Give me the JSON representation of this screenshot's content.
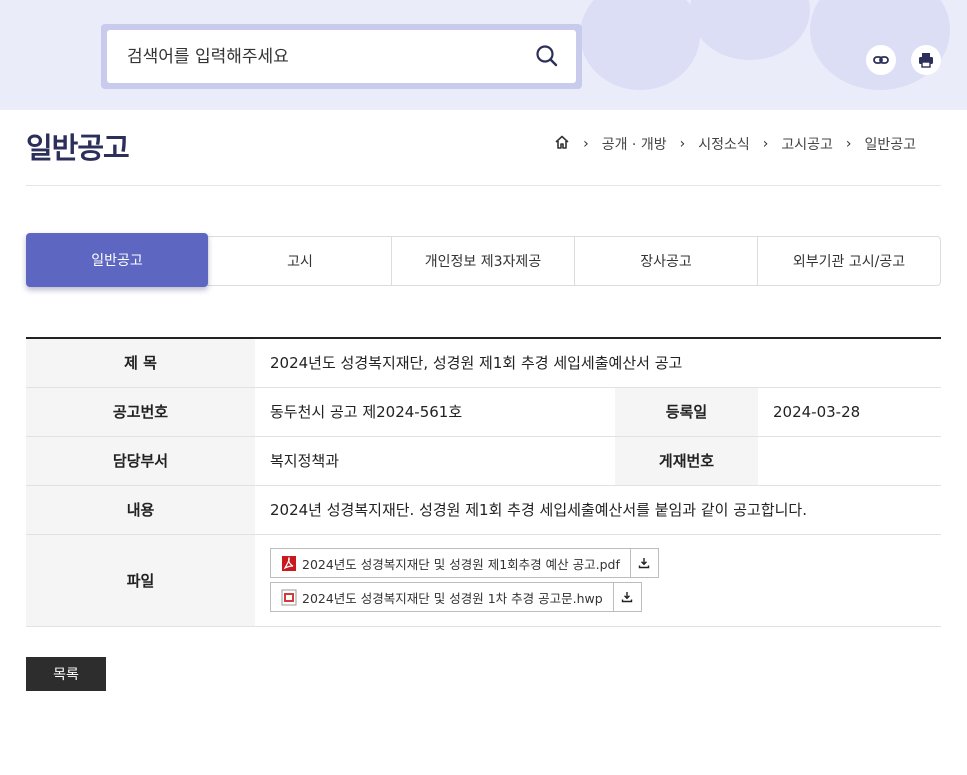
{
  "search": {
    "placeholder": "검색어를 입력해주세요"
  },
  "page": {
    "title": "일반공고"
  },
  "breadcrumb": [
    "공개 · 개방",
    "시정소식",
    "고시공고",
    "일반공고"
  ],
  "tabs": [
    {
      "label": "일반공고",
      "active": true
    },
    {
      "label": "고시",
      "active": false
    },
    {
      "label": "개인정보 제3자제공",
      "active": false
    },
    {
      "label": "장사공고",
      "active": false
    },
    {
      "label": "외부기관 고시/공고",
      "active": false
    }
  ],
  "detail": {
    "subject_label": "제 목",
    "subject": "2024년도 성경복지재단, 성경원 제1회 추경 세입세출예산서 공고",
    "notice_no_label": "공고번호",
    "notice_no": "동두천시 공고 제2024-561호",
    "reg_date_label": "등록일",
    "reg_date": "2024-03-28",
    "dept_label": "담당부서",
    "dept": "복지정책과",
    "post_no_label": "게재번호",
    "post_no": "",
    "content_label": "내용",
    "content": "2024년 성경복지재단. 성경원 제1회 추경 세입세출예산서를 붙임과 같이 공고합니다.",
    "file_label": "파일",
    "files": [
      {
        "name": "2024년도 성경복지재단 및 성경원 제1회추경 예산 공고.pdf",
        "type": "pdf"
      },
      {
        "name": "2024년도 성경복지재단 및 성경원 1차 추경 공고문.hwp",
        "type": "hwp"
      }
    ]
  },
  "buttons": {
    "list": "목록"
  },
  "colors": {
    "accent": "#5d66c1",
    "title": "#2b2f59",
    "band": "#ebecfa"
  }
}
